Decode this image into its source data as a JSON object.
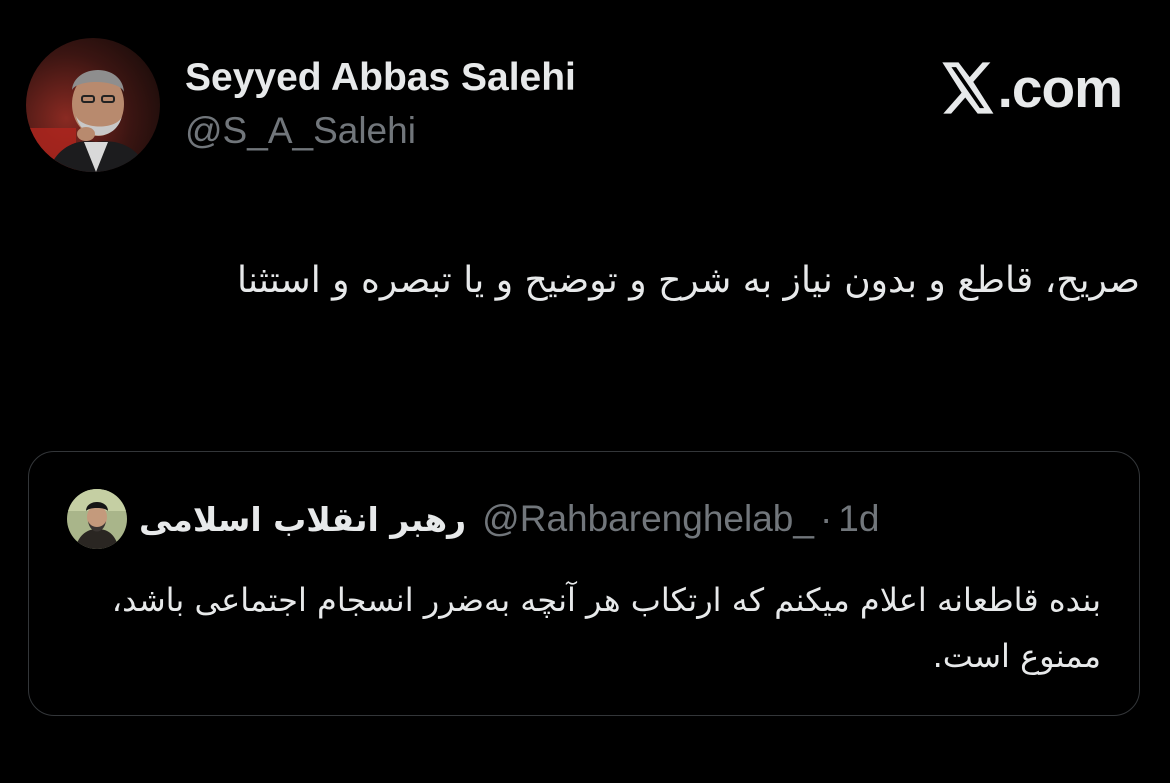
{
  "author": {
    "display_name": "Seyyed Abbas Salehi",
    "handle": "@S_A_Salehi",
    "avatar_icon": "profile-photo"
  },
  "brand": {
    "label": ".com",
    "icon": "x-logo-icon"
  },
  "tweet": {
    "text": "صریح، قاطع و بدون نیاز به شرح و توضیح  و یا تبصره و استثنا"
  },
  "quoted_tweet": {
    "display_name": "رهبر انقلاب اسلامی",
    "handle": "@Rahbarenghelab_",
    "separator": "·",
    "time": "1d",
    "text": "بنده قاطعانه اعلام میکنم که ارتکاب هر آنچه به‌ضرر انسجام اجتماعی باشد، ممنوع است.",
    "avatar_icon": "profile-photo"
  },
  "colors": {
    "background": "#000000",
    "primary_text": "#e7e9ea",
    "secondary_text": "#71767b",
    "card_border": "#333639"
  }
}
